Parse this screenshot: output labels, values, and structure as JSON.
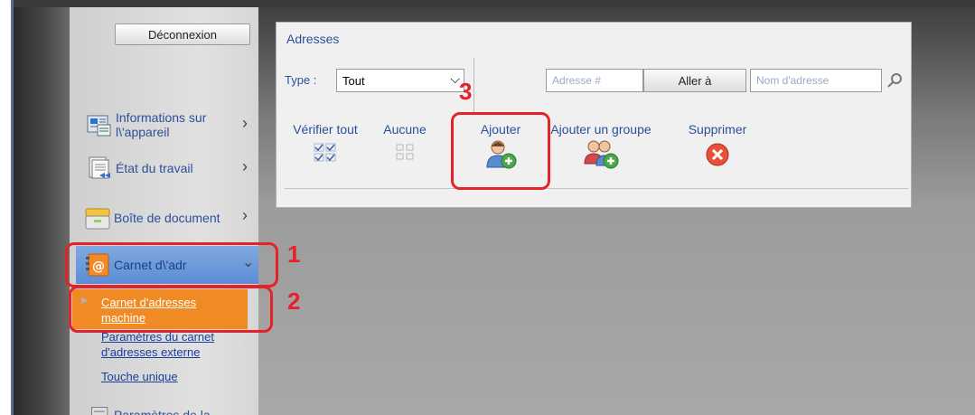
{
  "sidebar": {
    "logout_label": "Déconnexion",
    "items": [
      {
        "label_line1": "Informations sur",
        "label_line2": "l\\'appareil",
        "icon": "device-info-icon"
      },
      {
        "label": "État du travail",
        "icon": "job-status-icon"
      },
      {
        "label": "Boîte de document",
        "icon": "document-box-icon"
      },
      {
        "label": "Carnet d\\'adr",
        "icon": "address-book-icon"
      }
    ],
    "sub_items": {
      "machine_line1": "Carnet d'adresses",
      "machine_line2": "machine",
      "external_line1": "Paramètres du carnet",
      "external_line2": "d'adresses externe",
      "one_touch": "Touche unique",
      "more": "Paramètres de la"
    }
  },
  "panel": {
    "title": "Adresses",
    "type_label": "Type :",
    "type_value": "Tout",
    "address_number_placeholder": "Adresse #",
    "goto_label": "Aller à",
    "address_name_placeholder": "Nom d'adresse",
    "actions": {
      "check_all": "Vérifier tout",
      "none": "Aucune",
      "add": "Ajouter",
      "add_group": "Ajouter un groupe",
      "delete": "Supprimer"
    }
  },
  "callouts": {
    "one": "1",
    "two": "2",
    "three": "3"
  },
  "colors": {
    "callout_red": "#e5222a",
    "selected_orange": "#f08a24",
    "link_blue": "#2a4f9a"
  }
}
